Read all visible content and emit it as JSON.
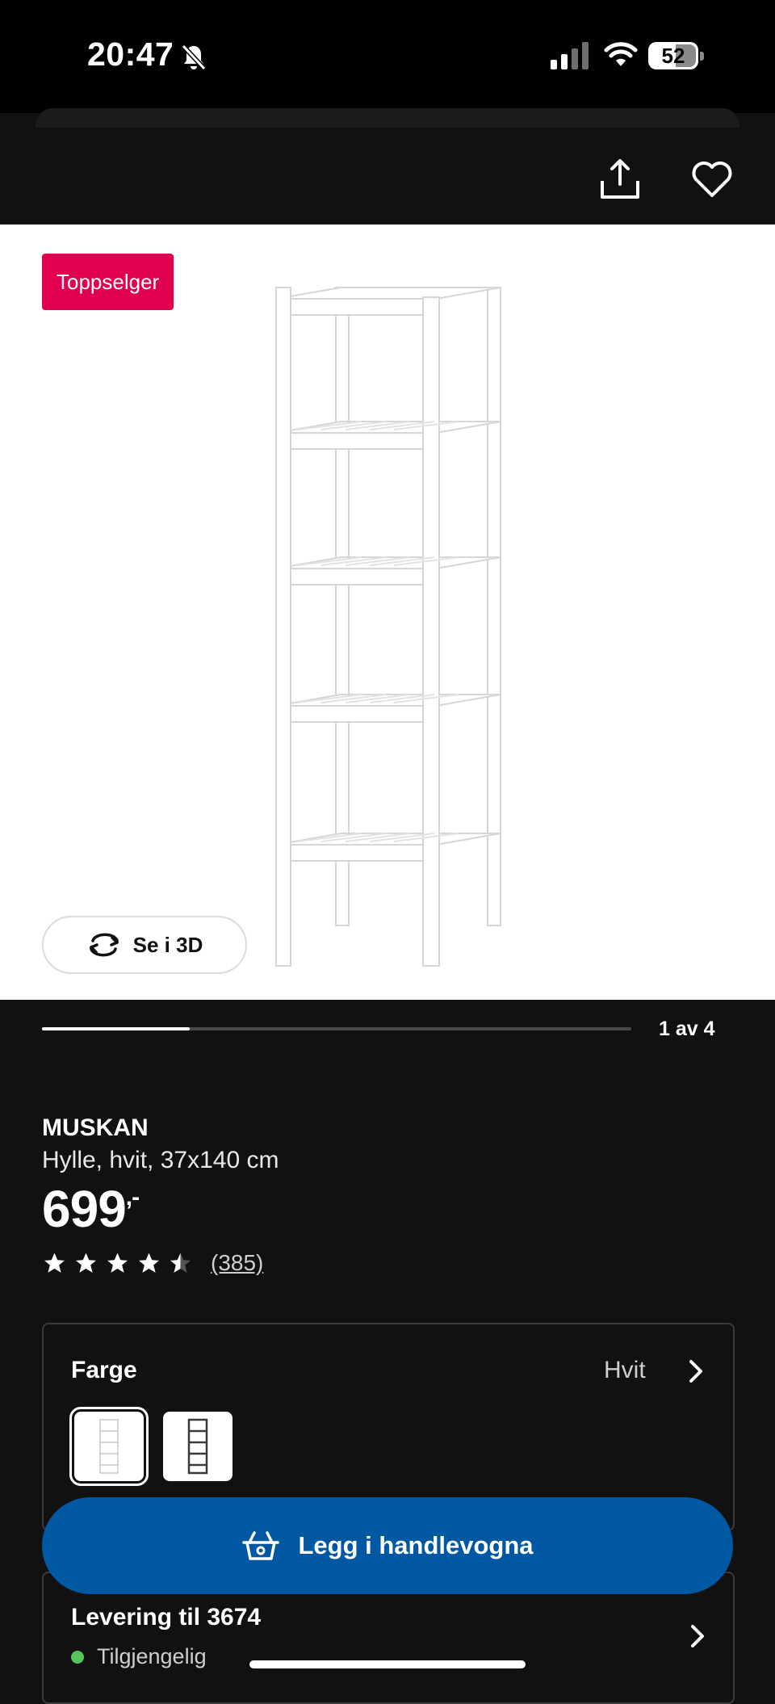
{
  "status_bar": {
    "time": "20:47",
    "battery_percent": 52,
    "battery_label": "52",
    "icons": [
      "bell-off-icon",
      "signal-icon",
      "wifi-icon",
      "battery-icon"
    ]
  },
  "toolbar": {
    "icons": [
      "share-icon",
      "heart-icon"
    ]
  },
  "gallery": {
    "badge": "Toppselger",
    "view_3d_label": "Se i 3D",
    "pager": "1 av 4",
    "current": 1,
    "total": 4
  },
  "product": {
    "name": "MUSKAN",
    "description": "Hylle, hvit, 37x140 cm",
    "price": "699",
    "price_suffix": ",-",
    "rating": 4.5,
    "rating_max": 5,
    "review_count": "(385)"
  },
  "color_selector": {
    "title": "Farge",
    "selected_value": "Hvit",
    "swatches": [
      "white",
      "dark-grey"
    ]
  },
  "cart_button": {
    "label": "Legg i handlevogna"
  },
  "delivery": {
    "title": "Levering til 3674",
    "status": "Tilgjengelig",
    "status_color": "#5ac35a"
  },
  "colors": {
    "background": "#111111",
    "badge": "#e0004f",
    "primary_button": "#0058a3"
  }
}
